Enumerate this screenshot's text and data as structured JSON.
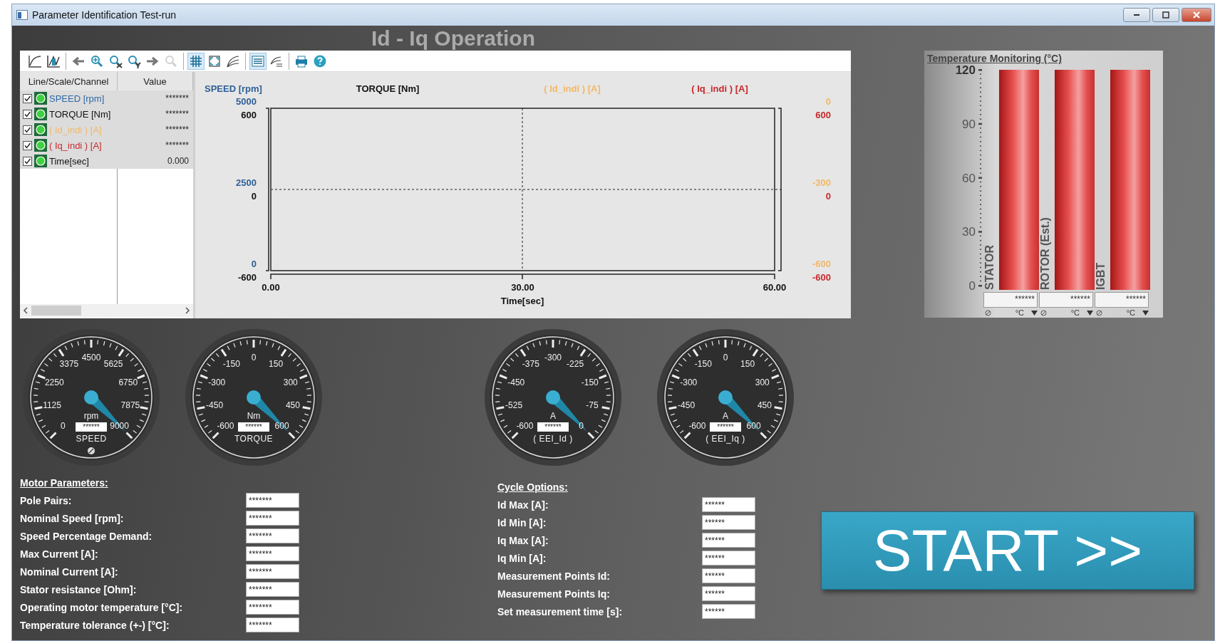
{
  "window": {
    "title": "Parameter Identification Test-run",
    "controls": [
      {
        "kind": "minimize"
      },
      {
        "kind": "maximize"
      },
      {
        "kind": "close"
      }
    ]
  },
  "heading": "Id - Iq Operation",
  "toolbar": [
    {
      "buttons": [
        {
          "kind": "curve",
          "selected": false,
          "disabled": false
        },
        {
          "kind": "curve-edit",
          "selected": false,
          "disabled": false
        }
      ]
    },
    {
      "buttons": [
        {
          "kind": "back",
          "selected": false,
          "disabled": false
        },
        {
          "kind": "zoom",
          "selected": false,
          "disabled": false
        },
        {
          "kind": "zoom-x",
          "selected": false,
          "disabled": false
        },
        {
          "kind": "zoom-y",
          "selected": false,
          "disabled": false
        },
        {
          "kind": "forward",
          "selected": false,
          "disabled": false
        },
        {
          "kind": "zoom-reset",
          "selected": false,
          "disabled": true
        }
      ]
    },
    {
      "buttons": [
        {
          "kind": "grid",
          "selected": true,
          "disabled": false
        },
        {
          "kind": "fit",
          "selected": false,
          "disabled": false
        },
        {
          "kind": "curves",
          "selected": false,
          "disabled": false
        }
      ]
    },
    {
      "buttons": [
        {
          "kind": "legend",
          "selected": true,
          "disabled": false
        },
        {
          "kind": "curve-list",
          "selected": false,
          "disabled": false
        }
      ]
    },
    {
      "buttons": [
        {
          "kind": "print",
          "selected": false,
          "disabled": false
        },
        {
          "kind": "help",
          "selected": false,
          "disabled": false
        }
      ]
    }
  ],
  "legend": {
    "columns": [
      "Line/Scale/Channel",
      "Value"
    ],
    "rows": [
      {
        "name": "SPEED [rpm]",
        "color": "#2f6aa8",
        "value": "*******",
        "checked": true
      },
      {
        "name": "TORQUE [Nm]",
        "color": "#111111",
        "value": "*******",
        "checked": true
      },
      {
        "name": "( Id_indi ) [A]",
        "color": "#f2b868",
        "value": "*******",
        "checked": true
      },
      {
        "name": "( Iq_indi ) [A]",
        "color": "#c8282c",
        "value": "*******",
        "checked": true
      },
      {
        "name": "Time[sec]",
        "color": "#111111",
        "value": "0.000",
        "checked": true
      }
    ]
  },
  "plot": {
    "axis_titles": [
      {
        "text": "SPEED [rpm]",
        "color": "#2e5f98"
      },
      {
        "text": "TORQUE [Nm]",
        "color": "#111111"
      },
      {
        "text": "( Id_indi ) [A]",
        "color": "#f2b868"
      },
      {
        "text": "( Iq_indi ) [A]",
        "color": "#c8282c"
      }
    ],
    "left_axes": [
      {
        "color": "#2e5f98",
        "ticks": [
          "5000",
          "2500",
          "0"
        ]
      },
      {
        "color": "#111111",
        "ticks": [
          "600",
          "0",
          "-600"
        ]
      }
    ],
    "right_axes": [
      {
        "color": "#f2b868",
        "ticks": [
          "0",
          "-300",
          "-600"
        ]
      },
      {
        "color": "#c8282c",
        "ticks": [
          "600",
          "0",
          "-600"
        ]
      }
    ],
    "x_ticks": [
      "0.00",
      "30.00",
      "60.00"
    ],
    "x_label": "Time[sec]"
  },
  "temperature": {
    "title": "Temperature Monitoring (°C)",
    "y_ticks": [
      "120",
      "90",
      "60",
      "30",
      "0"
    ],
    "bars": [
      {
        "label": "STATOR",
        "level": 1,
        "reading": "******",
        "unit": "°C"
      },
      {
        "label": "ROTOR (Est.)",
        "level": 1,
        "reading": "******",
        "unit": "°C"
      },
      {
        "label": "IGBT",
        "level": 1,
        "reading": "******",
        "unit": "°C"
      }
    ]
  },
  "gauges": [
    {
      "name": "SPEED",
      "unit": "rpm",
      "reading": "******",
      "status_icon": true,
      "labels": [
        "0",
        "1125",
        "2250",
        "3375",
        "4500",
        "5625",
        "6750",
        "7875",
        "9000"
      ]
    },
    {
      "name": "TORQUE",
      "unit": "Nm",
      "reading": "******",
      "labels": [
        "-600",
        "-450",
        "-300",
        "-150",
        "0",
        "150",
        "300",
        "450",
        "600"
      ]
    },
    {
      "name": "( EEI_Id )",
      "unit": "A",
      "reading": "******",
      "labels": [
        "-600",
        "-525",
        "-450",
        "-375",
        "-300",
        "-225",
        "-150",
        "-75",
        "0"
      ]
    },
    {
      "name": "( EEI_Iq )",
      "unit": "A",
      "reading": "******",
      "labels": [
        "-600",
        "-450",
        "-300",
        "-150",
        "0",
        "150",
        "300",
        "450",
        "600"
      ]
    }
  ],
  "motor_parameters": {
    "title": "Motor Parameters:",
    "fields": [
      {
        "label": "Pole Pairs:",
        "value": "*******"
      },
      {
        "label": "Nominal Speed [rpm]:",
        "value": "*******"
      },
      {
        "label": "Speed Percentage Demand:",
        "value": "*******"
      },
      {
        "label": "Max Current [A]:",
        "value": "*******"
      },
      {
        "label": "Nominal Current [A]:",
        "value": "*******"
      },
      {
        "label": "Stator resistance [Ohm]:",
        "value": "*******"
      },
      {
        "label": "Operating motor temperature [°C]:",
        "value": "*******"
      },
      {
        "label": "Temperature tolerance (+-) [°C]:",
        "value": "*******"
      }
    ]
  },
  "cycle_options": {
    "title": "Cycle Options:",
    "fields": [
      {
        "label": "Id Max [A]:",
        "value": "******"
      },
      {
        "label": "Id Min [A]:",
        "value": "******"
      },
      {
        "label": "Iq Max [A]:",
        "value": "******"
      },
      {
        "label": "Iq Min [A]:",
        "value": "******"
      },
      {
        "label": "Measurement Points Id:",
        "value": "******"
      },
      {
        "label": "Measurement Points Iq:",
        "value": "******"
      },
      {
        "label": "Set measurement time [s]:",
        "value": "******"
      }
    ]
  },
  "start_button": "START >>"
}
